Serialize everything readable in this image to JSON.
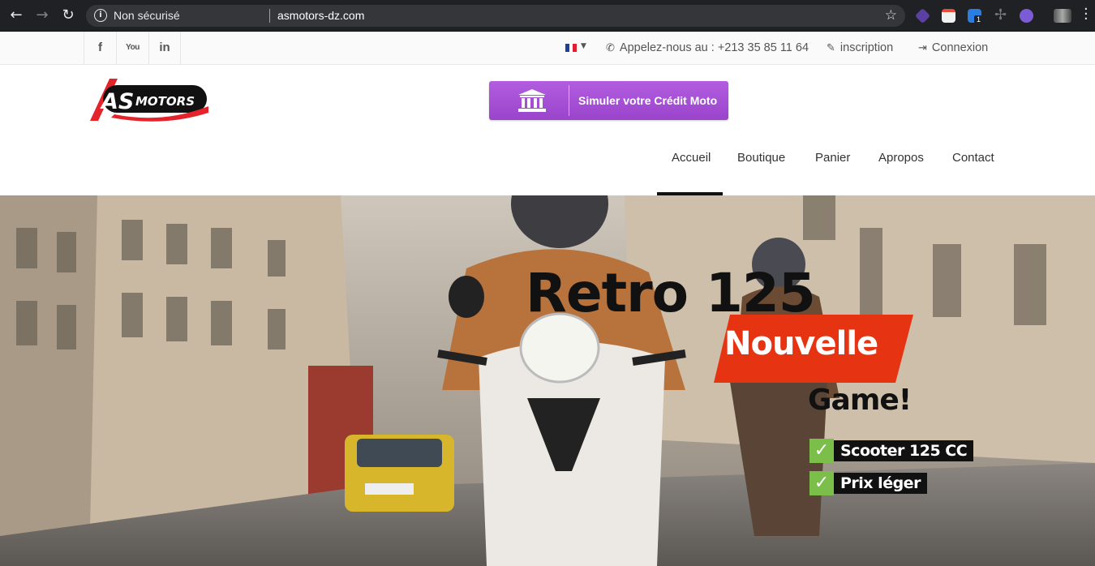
{
  "browser": {
    "security_label": "Non sécurisé",
    "url": "asmotors-dz.com",
    "ext_badge": "1"
  },
  "topbar": {
    "social": [
      "f",
      "You",
      "in"
    ],
    "phone": "Appelez-nous au : +213 35 85 11 64",
    "inscription": "inscription",
    "connexion": "Connexion"
  },
  "header": {
    "logo_text": "AS MOTORS",
    "credit_button": "Simuler votre Crédit Moto",
    "nav": [
      "Accueil",
      "Boutique",
      "Panier",
      "Apropos",
      "Contact"
    ],
    "active_nav": "Accueil"
  },
  "hero": {
    "title": "Retro 125",
    "badge": "Nouvelle",
    "subtitle": "Game!",
    "features": [
      "Scooter 125 CC",
      "Prix léger"
    ]
  },
  "colors": {
    "credit_button": "#a64fd6",
    "badge_red": "#e63312",
    "check_green": "#7bbf4a",
    "logo_red": "#e3242b"
  }
}
